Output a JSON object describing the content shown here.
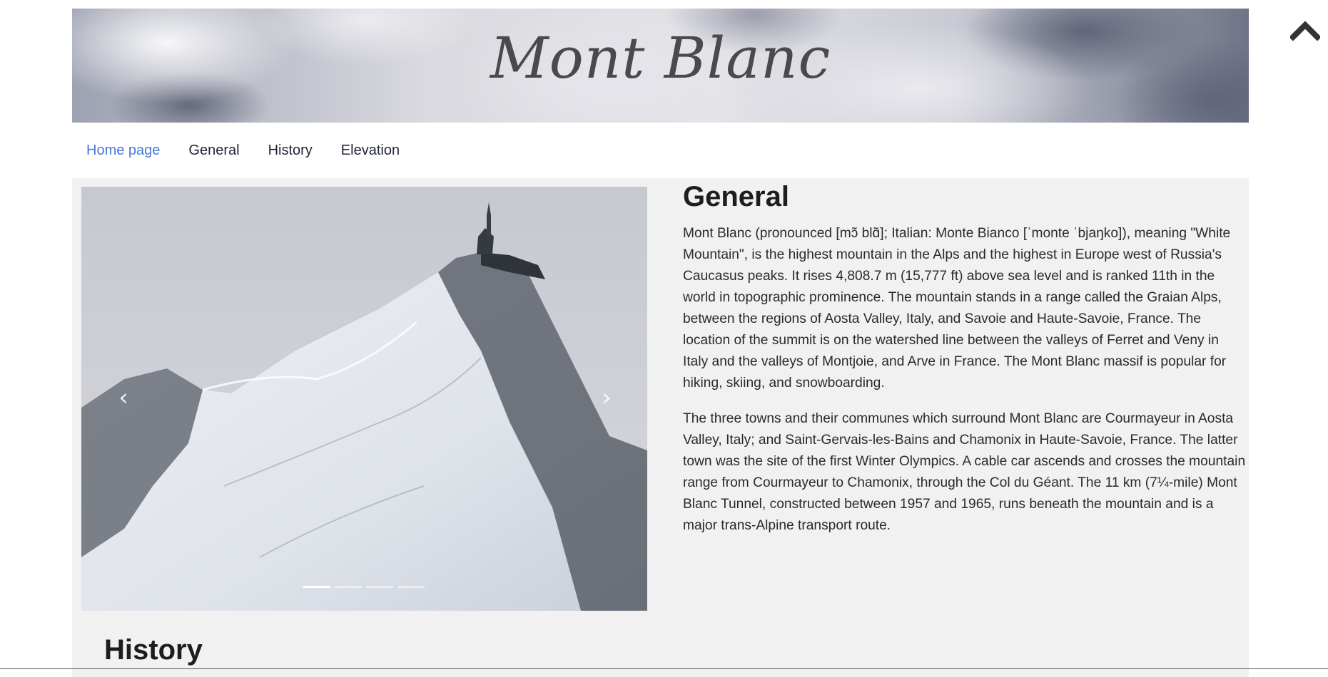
{
  "header": {
    "title": "Mont Blanc"
  },
  "nav": {
    "items": [
      {
        "label": "Home page",
        "active": true
      },
      {
        "label": "General",
        "active": false
      },
      {
        "label": "History",
        "active": false
      },
      {
        "label": "Elevation",
        "active": false
      }
    ]
  },
  "carousel": {
    "prev_icon": "chevron-left-icon",
    "next_icon": "chevron-right-icon",
    "slide_count": 4,
    "active_index": 0
  },
  "general": {
    "heading": "General",
    "paragraphs": [
      "Mont Blanc (pronounced [mɔ̃ blɑ̃]; Italian: Monte Bianco [ˈmonte ˈbjaŋko]), meaning \"White Mountain\", is the highest mountain in the Alps and the highest in Europe west of Russia's Caucasus peaks. It rises 4,808.7 m (15,777 ft) above sea level and is ranked 11th in the world in topographic prominence. The mountain stands in a range called the Graian Alps, between the regions of Aosta Valley, Italy, and Savoie and Haute-Savoie, France. The location of the summit is on the watershed line between the valleys of Ferret and Veny in Italy and the valleys of Montjoie, and Arve in France. The Mont Blanc massif is popular for hiking, skiing, and snowboarding.",
      "The three towns and their communes which surround Mont Blanc are Courmayeur in Aosta Valley, Italy; and Saint-Gervais-les-Bains and Chamonix in Haute-Savoie, France. The latter town was the site of the first Winter Olympics. A cable car ascends and crosses the mountain range from Courmayeur to Chamonix, through the Col du Géant. The 11 km (7¼-mile) Mont Blanc Tunnel, constructed between 1957 and 1965, runs beneath the mountain and is a major trans-Alpine transport route."
    ]
  },
  "history": {
    "heading": "History"
  },
  "back_to_top": {
    "icon": "chevron-up-icon"
  }
}
